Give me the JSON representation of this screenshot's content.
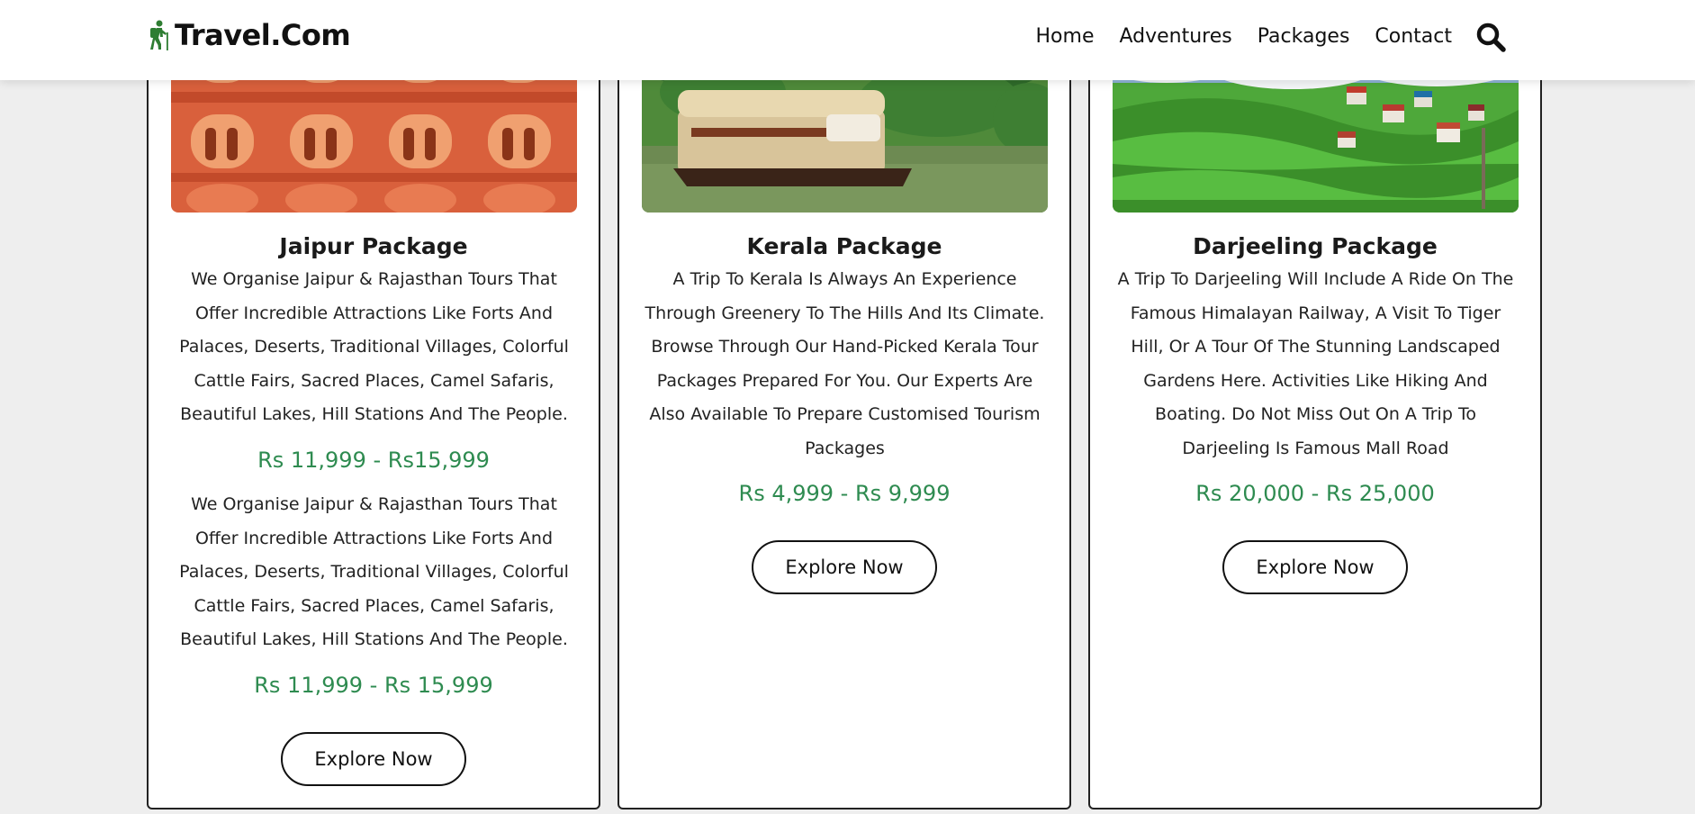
{
  "header": {
    "logo_text": "Travel.Com",
    "nav": [
      {
        "label": "Home"
      },
      {
        "label": "Adventures"
      },
      {
        "label": "Packages"
      },
      {
        "label": "Contact"
      }
    ]
  },
  "colors": {
    "accent_green": "#2e8b50",
    "logo_green": "#2e7d32",
    "background": "#eeeeee"
  },
  "cards": [
    {
      "image_name": "jaipur-image",
      "title": "Jaipur Package",
      "description": "We Organise Jaipur & Rajasthan Tours That Offer Incredible Attractions Like Forts And Palaces, Deserts, Traditional Villages, Colorful Cattle Fairs, Sacred Places, Camel Safaris, Beautiful Lakes, Hill Stations And The People.",
      "price": "Rs 11,999 - Rs15,999",
      "description_2": "We Organise Jaipur & Rajasthan Tours That Offer Incredible Attractions Like Forts And Palaces, Deserts, Traditional Villages, Colorful Cattle Fairs, Sacred Places, Camel Safaris, Beautiful Lakes, Hill Stations And The People.",
      "price_2": "Rs 11,999 - Rs 15,999",
      "button": "Explore Now"
    },
    {
      "image_name": "kerala-image",
      "title": "Kerala Package",
      "description": "A Trip To Kerala Is Always An Experience Through Greenery To The Hills And Its Climate. Browse Through Our Hand-Picked Kerala Tour Packages Prepared For You. Our Experts Are Also Available To Prepare Customised Tourism Packages",
      "price": "Rs 4,999 - Rs 9,999",
      "button": "Explore Now"
    },
    {
      "image_name": "darjeeling-image",
      "title": "Darjeeling Package",
      "description": "A Trip To Darjeeling Will Include A Ride On The Famous Himalayan Railway, A Visit To Tiger Hill, Or A Tour Of The Stunning Landscaped Gardens Here. Activities Like Hiking And Boating. Do Not Miss Out On A Trip To Darjeeling Is Famous Mall Road",
      "price": "Rs 20,000 - Rs 25,000",
      "button": "Explore Now"
    }
  ]
}
